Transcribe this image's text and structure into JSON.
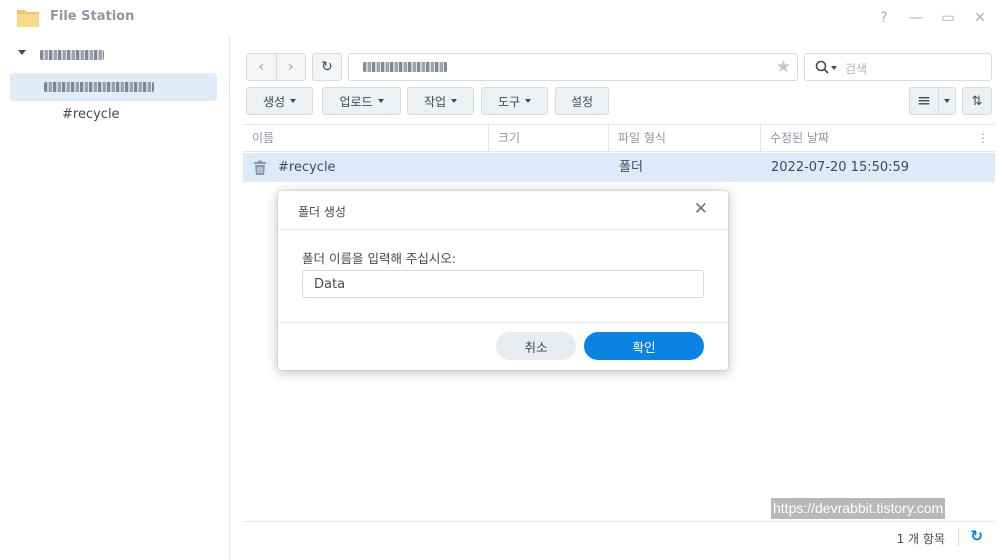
{
  "window": {
    "title": "File Station",
    "controls": {
      "help": "?",
      "minimize": "—",
      "maximize": "▭",
      "close": "✕"
    }
  },
  "sidebar": {
    "root_label_redacted": true,
    "selected_label_redacted": true,
    "child_label": "#recycle"
  },
  "toolbar": {
    "back_icon": "‹",
    "forward_icon": "›",
    "refresh_icon": "↻",
    "path_redacted": true,
    "star_icon": "★",
    "search_placeholder": "검색",
    "actions": [
      "생성",
      "업로드",
      "작업",
      "도구",
      "설정"
    ],
    "list_view_icon": "≡",
    "sort_icon": "⇅"
  },
  "file_list": {
    "columns": [
      "이름",
      "크기",
      "파일 형식",
      "수정된 날짜"
    ],
    "column_menu_icon": "⋮",
    "rows": [
      {
        "name": "#recycle",
        "size": "",
        "type": "폴더",
        "modified": "2022-07-20 15:50:59",
        "icon": "trash-icon"
      }
    ]
  },
  "status": {
    "item_count": "1 개 항목",
    "refresh_icon": "↻"
  },
  "watermark": "https://devrabbit.tistory.com",
  "dialog": {
    "title": "폴더 생성",
    "close_icon": "✕",
    "prompt": "폴더 이름을 입력해 주십시오:",
    "input_value": "Data",
    "cancel_label": "취소",
    "ok_label": "확인"
  },
  "colors": {
    "accent": "#0a84e0",
    "selected_row": "#dcebfa",
    "tree_selected": "#e0edf9"
  }
}
